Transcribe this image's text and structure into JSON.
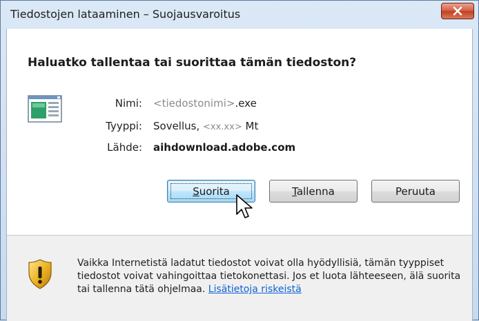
{
  "window": {
    "title": "Tiedostojen lataaminen – Suojausvaroitus",
    "close_icon": "close-x-icon"
  },
  "dialog": {
    "question": "Haluatko tallentaa tai suorittaa tämän tiedoston?",
    "file_icon": "executable-window-icon",
    "fields": {
      "name_label": "Nimi:",
      "name_placeholder": "<tiedostonimi>",
      "name_ext": ".exe",
      "type_label": "Tyyppi:",
      "type_prefix": "Sovellus,",
      "type_size": "<xx.xx>",
      "type_unit": "Mt",
      "source_label": "Lähde:",
      "source_value": "aihdownload.adobe.com"
    },
    "buttons": {
      "run_accel": "S",
      "run_rest": "uorita",
      "save_accel": "T",
      "save_rest": "allenna",
      "cancel": "Peruuta"
    }
  },
  "warning": {
    "icon": "security-shield-warning-icon",
    "text": "Vaikka Internetistä ladatut tiedostot voivat olla hyödyllisiä, tämän tyyppiset tiedostot voivat vahingoittaa tietokonettasi. Jos et luota lähteeseen, älä suorita tai tallenna tätä ohjelmaa.",
    "link": "Lisätietoja riskeistä"
  },
  "colors": {
    "link": "#0f62d6",
    "default_button_border": "#3c7fb1",
    "close_button": "#c2401f",
    "shield_gold": "#e8b021"
  }
}
